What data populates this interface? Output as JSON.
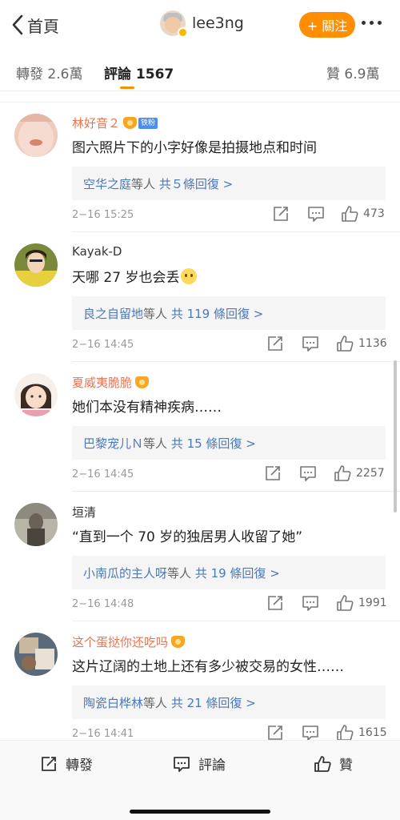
{
  "header": {
    "back_label": "首頁",
    "username": "lee3ng",
    "follow_label": "+ 關注"
  },
  "tabs": {
    "repost": "轉發 2.6萬",
    "comments": "評論 1567",
    "likes": "贊 6.9萬"
  },
  "colors": {
    "accent": "#ff8f00",
    "link": "#4a78b8",
    "vip_name": "#eb7350"
  },
  "comments": [
    {
      "name": "林好音２",
      "fan_badge": "铁粉",
      "text": "图六照片下的小字好像是拍摄地点和时间",
      "reply_user": "空华之庭",
      "reply_mid": "等人",
      "reply_count": "共５條回復 >",
      "time": "2−16 15:25",
      "likes": "473"
    },
    {
      "name": "Kayak-D",
      "text": "天哪 27 岁也会丢",
      "reply_user": "良之自留地",
      "reply_mid": "等人",
      "reply_count": "共 119 條回復 >",
      "time": "2−16 14:45",
      "likes": "1136"
    },
    {
      "name": "夏威夷脆脆",
      "text": "她们本没有精神疾病……",
      "reply_user": "巴黎宠儿Ｎ",
      "reply_mid": "等人",
      "reply_count": "共 15 條回復 >",
      "time": "2−16 14:45",
      "likes": "2257"
    },
    {
      "name": "垣清",
      "text": "“直到一个 70 岁的独居男人收留了她”",
      "reply_user": "小南瓜的主人呀",
      "reply_mid": "等人",
      "reply_count": "共 19 條回復 >",
      "time": "2−16 14:48",
      "likes": "1991"
    },
    {
      "name": "这个蛋挞你还吃吗",
      "text": "这片辽阔的土地上还有多少被交易的女性……",
      "reply_user": "陶瓷白桦林",
      "reply_mid": "等人",
      "reply_count": "共 21 條回復 >",
      "time": "2−16 14:41",
      "likes": "1615"
    }
  ],
  "bottom": {
    "repost": "轉發",
    "comment": "評論",
    "like": "贊"
  }
}
